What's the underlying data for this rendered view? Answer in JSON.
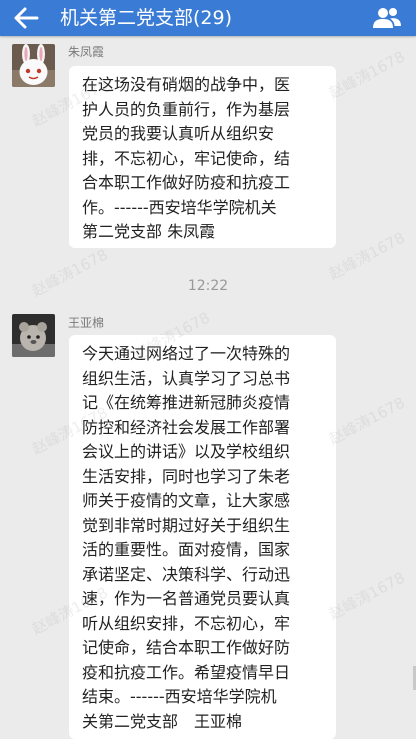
{
  "header": {
    "title": "机关第二党支部(29)",
    "back_icon": "back-arrow-icon",
    "members_icon": "group-members-icon",
    "bar_color": "#3a7bd5"
  },
  "messages": [
    {
      "sender": "朱凤霞",
      "text": "在这场没有硝烟的战争中，医\n护人员的负重前行，作为基层\n党员的我要认真听从组织安\n排，不忘初心，牢记使命，结\n合本职工作做好防疫和抗疫工\n作。------西安培华学院机关\n第二党支部 朱凤霞"
    },
    {
      "sender": "王亚棉",
      "text": "今天通过网络过了一次特殊的\n组织生活，认真学习了习总书\n记《在统筹推进新冠肺炎疫情\n防控和经济社会发展工作部署\n会议上的讲话》以及学校组织\n生活安排，同时也学习了朱老\n师关于疫情的文章，让大家感\n觉到非常时期过好关于组织生\n活的重要性。面对疫情，国家\n承诺坚定、决策科学、行动迅\n速，作为一名普通党员要认真\n听从组织安排，不忘初心，牢\n记使命，结合本职工作做好防\n疫和抗疫工作。希望疫情早日\n结束。------西安培华学院机\n关第二党支部　王亚棉"
    }
  ],
  "timestamp": "12:22",
  "watermark": "赵峰涛1678"
}
